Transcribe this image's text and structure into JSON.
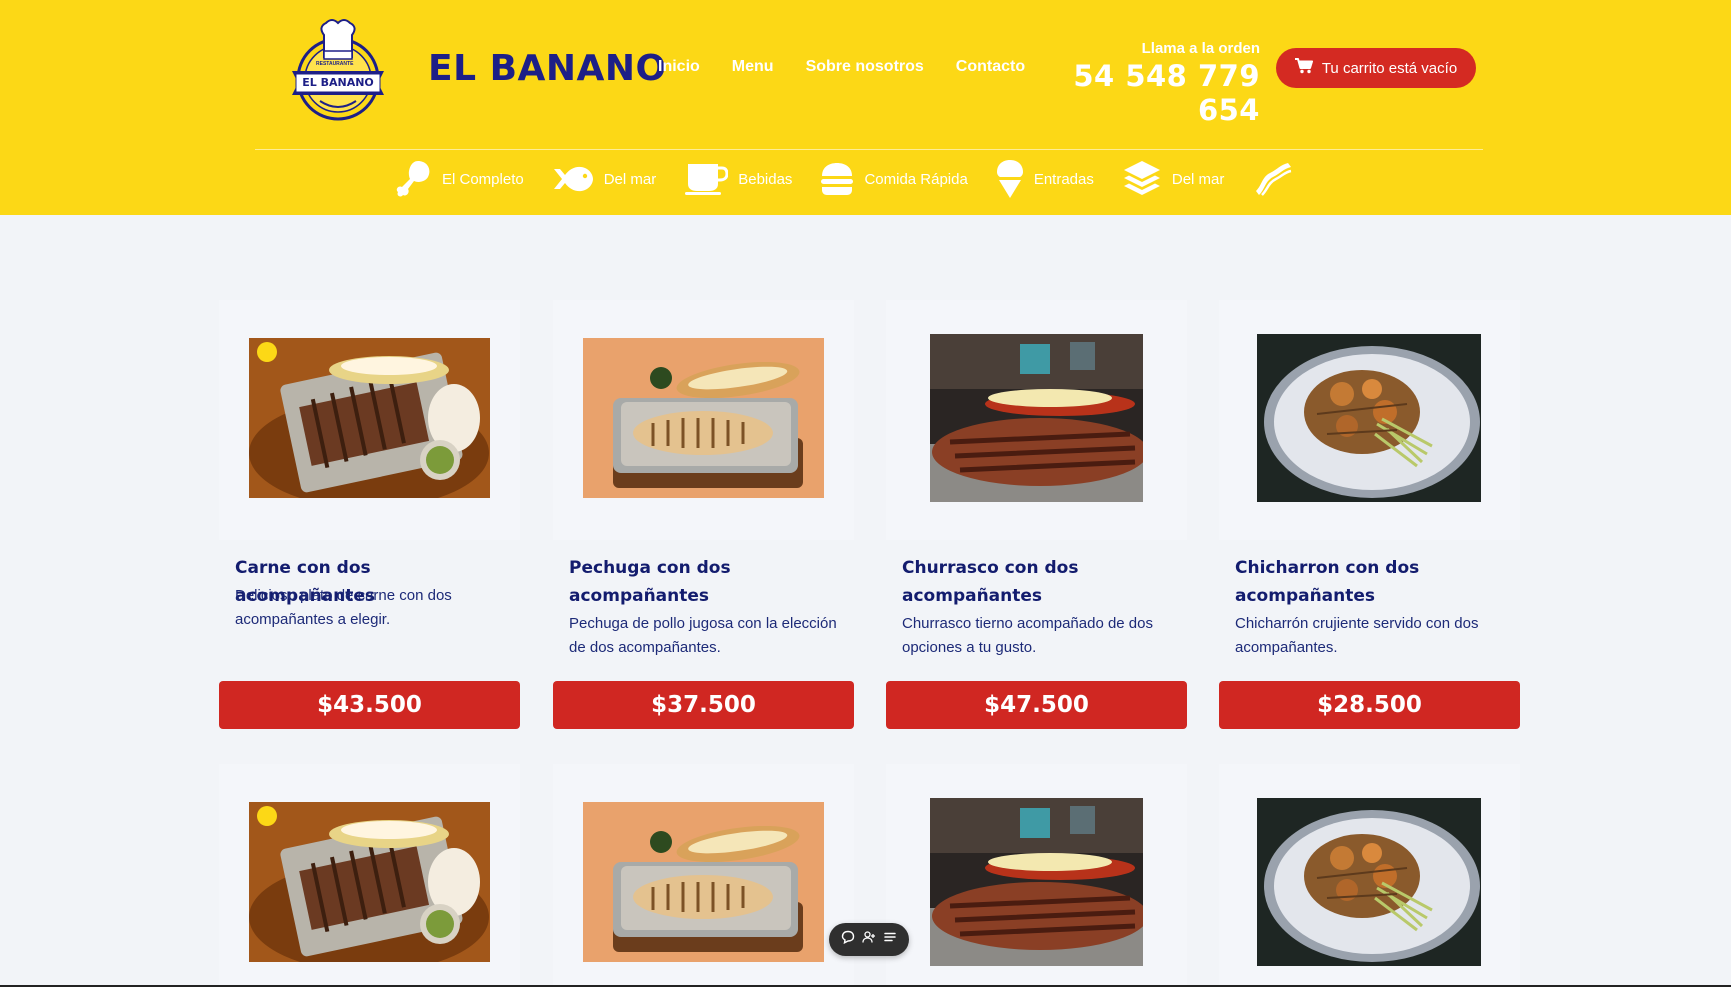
{
  "brand": {
    "name": "EL BANANO",
    "logo_text": "EL BANANO",
    "logo_top": "RESTAURANTE"
  },
  "nav": [
    "Inicio",
    "Menu",
    "Sobre nosotros",
    "Contacto"
  ],
  "call": {
    "label": "Llama a la orden",
    "phone": "54 548 779 654"
  },
  "cart": {
    "label": "Tu carrito está vacío",
    "icon": "cart-icon"
  },
  "categories": [
    {
      "label": "El Completo",
      "icon": "drumstick-icon"
    },
    {
      "label": "Del mar",
      "icon": "fish-icon"
    },
    {
      "label": "Bebidas",
      "icon": "mug-icon"
    },
    {
      "label": "Comida Rápida",
      "icon": "burger-icon"
    },
    {
      "label": "Entradas",
      "icon": "ice-cream-icon"
    },
    {
      "label": "Del mar",
      "icon": "layers-icon"
    },
    {
      "label": "",
      "icon": "bacon-icon"
    }
  ],
  "products": [
    {
      "title": "Carne con dos acompañantes",
      "desc": "Delicioso plato de carne con dos acompañantes a elegir.",
      "price": "$43.500"
    },
    {
      "title": "Pechuga con dos acompañantes",
      "desc": "Pechuga de pollo jugosa con la elección de dos acompañantes.",
      "price": "$37.500"
    },
    {
      "title": "Churrasco con dos acompañantes",
      "desc": "Churrasco tierno acompañado de dos opciones a tu gusto.",
      "price": "$47.500"
    },
    {
      "title": "Chicharron con dos acompañantes",
      "desc": "Chicharrón crujiente servido con dos acompañantes.",
      "price": "$28.500"
    }
  ],
  "colors": {
    "header": "#fcd816",
    "brand": "#1d1f87",
    "accent_red": "#d02722",
    "page_bg": "#f2f4f8"
  }
}
